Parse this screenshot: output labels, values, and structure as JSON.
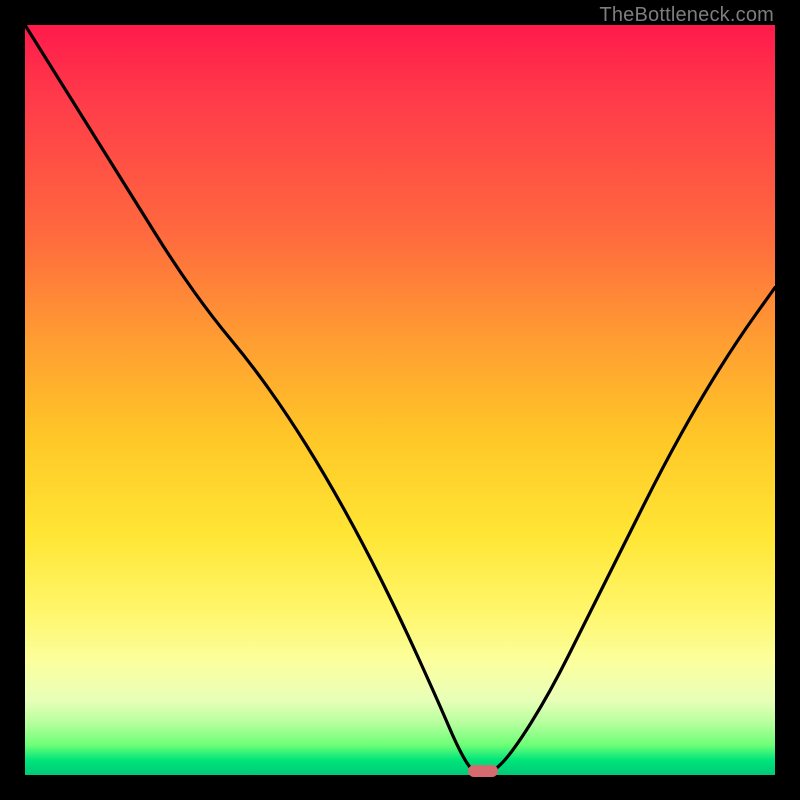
{
  "watermark": "TheBottleneck.com",
  "colors": {
    "background": "#000000",
    "curve": "#000000",
    "marker": "#d66b6f",
    "gradient_top": "#ff1a4b",
    "gradient_bottom": "#00c978"
  },
  "chart_data": {
    "type": "line",
    "title": "",
    "xlabel": "",
    "ylabel": "",
    "xlim": [
      0,
      100
    ],
    "ylim": [
      0,
      100
    ],
    "series": [
      {
        "name": "bottleneck-curve",
        "x": [
          0,
          5,
          10,
          15,
          20,
          25,
          30,
          35,
          40,
          45,
          50,
          55,
          58,
          60,
          62,
          65,
          70,
          75,
          80,
          85,
          90,
          95,
          100
        ],
        "values": [
          100,
          92,
          84,
          76,
          68,
          61,
          55,
          48,
          40,
          31,
          21,
          10,
          3,
          0,
          0,
          3,
          11,
          21,
          31,
          41,
          50,
          58,
          65
        ]
      }
    ],
    "marker": {
      "x": 61,
      "y": 0.5
    },
    "annotations": []
  }
}
